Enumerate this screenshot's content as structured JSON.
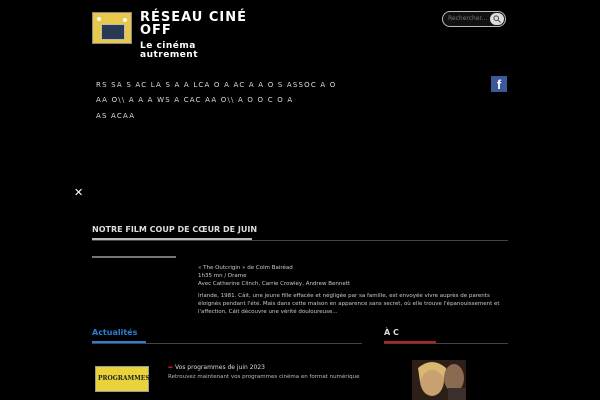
{
  "header": {
    "title_line1": "RÉSEAU CINÉ",
    "title_line2": "OFF",
    "tagline_line1": "Le cinéma",
    "tagline_line2": "autrement"
  },
  "search": {
    "placeholder": "Rechercher..."
  },
  "nav": {
    "row1": "RS   SA   S  AC  LA    S    A  A    LCA  O  A  AC     A  A O S     ASSOC A  O",
    "row2": "AA O\\\\  A  A  A  WS          A  CAC   AA O\\\\    A       O      O  C O      A",
    "row3": "AS  ACAA"
  },
  "close_icon_glyph": "✕",
  "film_section": {
    "title": "NOTRE FILM COUP DE CŒUR DE JUIN",
    "line1": "« The Outcrigin » de Colm Bairéad",
    "line2": "1h35 mn / Drame",
    "line3": "Avec Catherine Clinch, Carrie Crowley, Andrew Bennett",
    "synopsis": "Irlande, 1981. Cáit, une jeune fille effacée et négligée par sa famille, est envoyée vivre auprès de parents éloignés pendant l'été. Mais dans cette maison en apparence sans secret, où elle trouve l'épanouissement et l'affection, Cáit découvre une vérité douloureuse..."
  },
  "news_section": {
    "title": "Actualités",
    "item_link": "Vos programmes de juin 2023",
    "item_desc": "Retrouvez maintenant vos programmes cinéma en format numérique"
  },
  "side_section": {
    "title": "À  C"
  },
  "thumb_label": "PROGRAMMES",
  "colors": {
    "accent_blue": "#2a7fd4",
    "accent_red": "#c0201c",
    "facebook": "#3b5998",
    "logo_bg": "#e8c84a"
  }
}
